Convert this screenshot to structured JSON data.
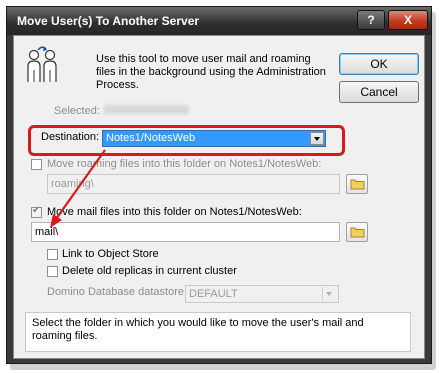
{
  "window": {
    "title": "Move User(s) To Another Server",
    "help_label": "?",
    "close_label": "X"
  },
  "intro": {
    "text": "Use this tool to move user mail and roaming files in the background using the Administration Process."
  },
  "buttons": {
    "ok": "OK",
    "cancel": "Cancel"
  },
  "selected": {
    "label": "Selected:"
  },
  "destination": {
    "label": "Destination:",
    "value": "Notes1/NotesWeb"
  },
  "roaming": {
    "checkbox_label": "Move roaming files into this folder on Notes1/NotesWeb:",
    "checked": false,
    "folder_value": "roaming\\"
  },
  "mail": {
    "checkbox_label": "Move mail files into this folder on Notes1/NotesWeb:",
    "checked": true,
    "folder_value": "mail\\"
  },
  "options": {
    "link_label": "Link to Object Store",
    "delete_label": "Delete old replicas in current cluster",
    "datastore_label": "Domino Database datastore:",
    "datastore_value": "DEFAULT"
  },
  "hint": {
    "text": "Select the folder in which you would like to move the user's mail and roaming files."
  },
  "colors": {
    "highlight": "#d81a1a",
    "selection": "#3399ff",
    "title_bar": "#2e2e2e"
  }
}
